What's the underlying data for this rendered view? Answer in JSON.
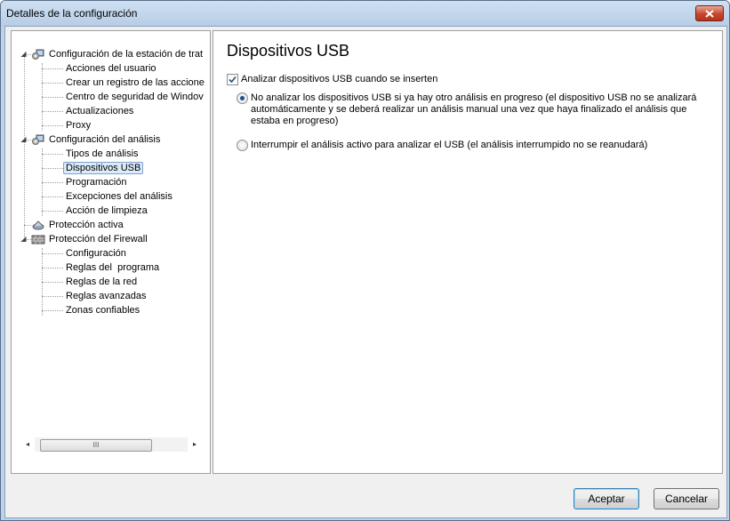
{
  "window": {
    "title": "Detalles de la configuración"
  },
  "tree": {
    "groups": [
      {
        "label": "Configuración de la estación de trat",
        "icon": "workstation-config-icon",
        "children": [
          "Acciones del usuario",
          "Crear un registro de las accione",
          "Centro de seguridad de Windov",
          "Actualizaciones",
          "Proxy"
        ]
      },
      {
        "label": "Configuración del análisis",
        "icon": "scan-config-icon",
        "children": [
          "Tipos de análisis",
          "Dispositivos USB",
          "Programación",
          "Excepciones del análisis",
          "Acción de limpieza"
        ]
      },
      {
        "label": "Protección activa",
        "icon": "active-protection-icon",
        "children": []
      },
      {
        "label": "Protección del Firewall",
        "icon": "firewall-icon",
        "children": [
          "Configuración",
          "Reglas del  programa",
          "Reglas de la red",
          "Reglas avanzadas",
          "Zonas confiables"
        ]
      }
    ],
    "selected": "Dispositivos USB",
    "scrollbar": {
      "thumb_glyph": "III"
    }
  },
  "content": {
    "title": "Dispositivos USB",
    "scan_usb": {
      "label": "Analizar dispositivos USB cuando se inserten",
      "checked": true
    },
    "options": [
      {
        "label": "No analizar los dispositivos USB si ya hay otro análisis en progreso (el dispositivo USB no se analizará automáticamente y se deberá realizar un análisis manual una vez que haya finalizado el análisis que estaba en progreso)",
        "selected": true
      },
      {
        "label": "Interrumpir el análisis activo para analizar el USB (el análisis interrumpido no se reanudará)",
        "selected": false
      }
    ]
  },
  "footer": {
    "accept_label": "Aceptar",
    "cancel_label": "Cancelar"
  }
}
